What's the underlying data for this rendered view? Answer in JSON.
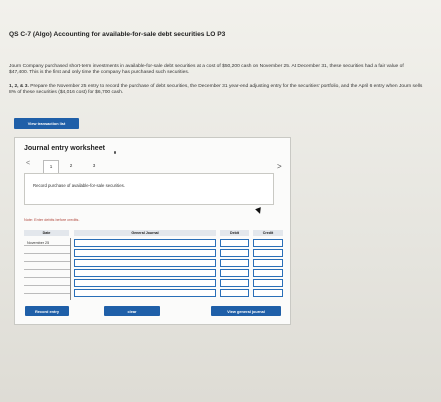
{
  "header": {
    "title": "QS C-7 (Algo) Accounting for available-for-sale debt securities LO P3"
  },
  "problem": {
    "paragraph1": "Journ Company purchased short-term investments in available-for-sale debt securities at a cost of $50,200 cash on November 25. At December 31, these securities had a fair value of $47,400. This is the first and only time the company has purchased such securities.",
    "paragraph2_prefix": "1, 2, & 3.",
    "paragraph2": " Prepare the November 25 entry to record the purchase of debt securities, the December 31 year-end adjusting entry for the securities' portfolio, and the April 6 entry when Journ sells 8% of these securities ($4,016 cost) for $6,700 cash."
  },
  "buttons": {
    "view_transaction_list": "View transaction list",
    "record_entry": "Record entry",
    "clear_entry": "clear",
    "view_general_journal": "View general journal"
  },
  "worksheet": {
    "title": "Journal entry worksheet",
    "tabs": [
      "1",
      "2",
      "3"
    ],
    "active_tab": 1,
    "prev_label": "<",
    "next_label": ">",
    "description": "Record purchase of available-for-sale securities.",
    "note": "Note: Enter debits before credits."
  },
  "journal": {
    "columns": {
      "date": "Date",
      "general_journal": "General Journal",
      "debit": "Debit",
      "credit": "Credit"
    },
    "rows": [
      {
        "date": "November 25"
      },
      {
        "date": ""
      },
      {
        "date": ""
      },
      {
        "date": ""
      },
      {
        "date": ""
      },
      {
        "date": ""
      }
    ]
  },
  "colors": {
    "accent_blue": "#1f5fa8",
    "grid_blue": "#2a6fb8",
    "note_red": "#b0463b"
  }
}
